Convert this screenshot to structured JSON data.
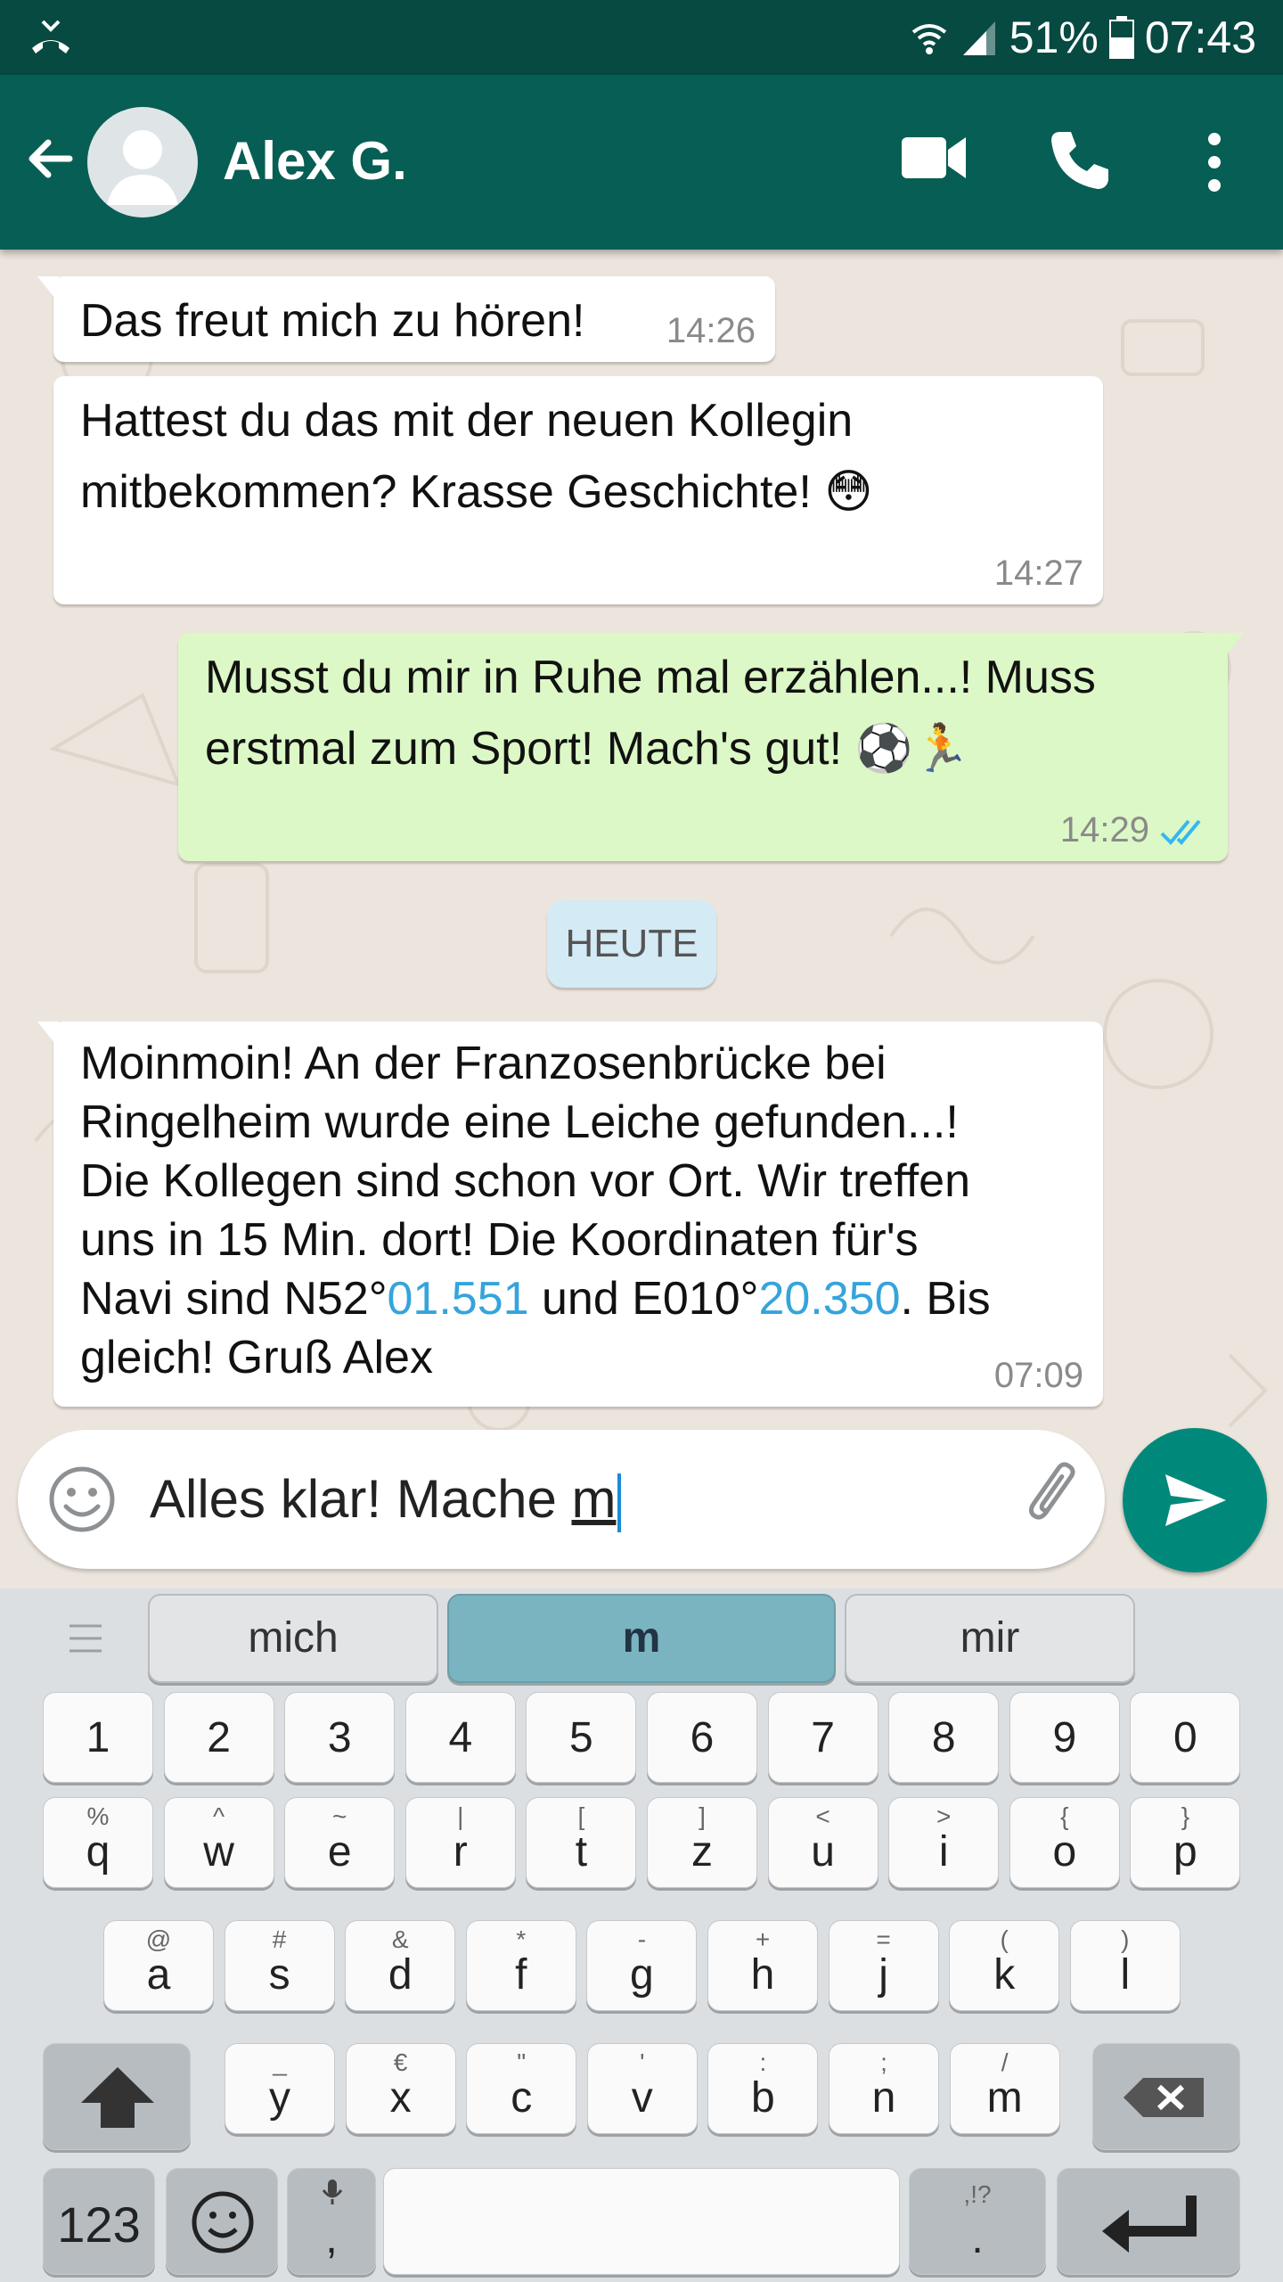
{
  "status_bar": {
    "battery": "51%",
    "time": "07:43"
  },
  "header": {
    "contact_name": "Alex G."
  },
  "messages": [
    {
      "direction": "in",
      "text": "Das freut mich zu hören!",
      "time": "14:26"
    },
    {
      "direction": "in",
      "text_lines": [
        "Hattest du das mit der neuen Kollegin",
        "mitbekommen? Krasse Geschichte! 😳"
      ],
      "time": "14:27"
    },
    {
      "direction": "out",
      "text_lines": [
        "Musst du mir in Ruhe mal erzählen...! Muss",
        "erstmal zum Sport! Mach's gut! ⚽🏃"
      ],
      "time": "14:29",
      "status": "read"
    },
    {
      "direction": "in",
      "text_lines": [
        "Moinmoin! An der Franzosenbrücke bei",
        "Ringelheim wurde eine Leiche gefunden...!",
        "Die Kollegen sind schon vor Ort. Wir treffen",
        "uns in 15 Min. dort! Die Koordinaten für's"
      ],
      "line5_a": "Navi sind N52°",
      "link1": "01.551",
      "line5_b": " und E010°",
      "link2": "20.350",
      "line5_c": ". Bis",
      "line6": "gleich! Gruß Alex",
      "time": "07:09"
    }
  ],
  "date_divider": "HEUTE",
  "composer": {
    "text_prefix": "Alles klar! Mache ",
    "text_underlined": "m"
  },
  "keyboard": {
    "suggestions": [
      "mich",
      "m",
      "mir"
    ],
    "number_row": [
      "1",
      "2",
      "3",
      "4",
      "5",
      "6",
      "7",
      "8",
      "9",
      "0"
    ],
    "row1": [
      {
        "k": "q",
        "s": "%"
      },
      {
        "k": "w",
        "s": "^"
      },
      {
        "k": "e",
        "s": "~"
      },
      {
        "k": "r",
        "s": "|"
      },
      {
        "k": "t",
        "s": "["
      },
      {
        "k": "z",
        "s": "]"
      },
      {
        "k": "u",
        "s": "<"
      },
      {
        "k": "i",
        "s": ">"
      },
      {
        "k": "o",
        "s": "{"
      },
      {
        "k": "p",
        "s": "}"
      }
    ],
    "row2": [
      {
        "k": "a",
        "s": "@"
      },
      {
        "k": "s",
        "s": "#"
      },
      {
        "k": "d",
        "s": "&"
      },
      {
        "k": "f",
        "s": "*"
      },
      {
        "k": "g",
        "s": "-"
      },
      {
        "k": "h",
        "s": "+"
      },
      {
        "k": "j",
        "s": "="
      },
      {
        "k": "k",
        "s": "("
      },
      {
        "k": "l",
        "s": ")"
      }
    ],
    "row3": [
      {
        "k": "y",
        "s": "_"
      },
      {
        "k": "x",
        "s": "€"
      },
      {
        "k": "c",
        "s": "\""
      },
      {
        "k": "v",
        "s": "'"
      },
      {
        "k": "b",
        "s": ":"
      },
      {
        "k": "n",
        "s": ";"
      },
      {
        "k": "m",
        "s": "/"
      }
    ],
    "numbers_key": "123",
    "comma_key": ",",
    "period_key": ".",
    "period_sub": ",!?"
  },
  "colors": {
    "header": "#075e54",
    "status": "#064a42",
    "out_bubble": "#dcf8c6",
    "link": "#34a4dc",
    "send": "#00897b"
  }
}
